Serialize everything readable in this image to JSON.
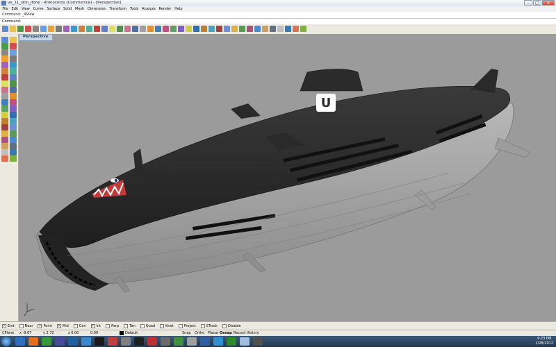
{
  "window": {
    "title": "ve_11_skin_done - Rhinoceros (Commercial) - [Perspective]",
    "min": "–",
    "max": "□",
    "close": "✕"
  },
  "menu": [
    "File",
    "Edit",
    "View",
    "Curve",
    "Surface",
    "Solid",
    "Mesh",
    "Dimension",
    "Transform",
    "Tools",
    "Analyze",
    "Render",
    "Help"
  ],
  "command": {
    "history_line": "Command: _4View",
    "prompt_label": "Command:",
    "value": ""
  },
  "viewport": {
    "name": "Perspective",
    "logo_text": "U"
  },
  "osnaps": [
    {
      "label": "End",
      "checked": true
    },
    {
      "label": "Near",
      "checked": false
    },
    {
      "label": "Point",
      "checked": true
    },
    {
      "label": "Mid",
      "checked": true
    },
    {
      "label": "Cen",
      "checked": false
    },
    {
      "label": "Int",
      "checked": true
    },
    {
      "label": "Perp",
      "checked": false
    },
    {
      "label": "Tan",
      "checked": false
    },
    {
      "label": "Quad",
      "checked": false
    },
    {
      "label": "Knot",
      "checked": false
    },
    {
      "label": "Project",
      "checked": false
    },
    {
      "label": "STrack",
      "checked": false
    },
    {
      "label": "Disable",
      "checked": false
    }
  ],
  "status": {
    "cplane": "CPlane",
    "x": "x -9.67",
    "y": "y 2.72",
    "z": "z 0.00",
    "dist": "0.00",
    "layer": "Default",
    "snap": "Snap",
    "ortho": "Ortho",
    "planar": "Planar",
    "osnap": "Osnap",
    "history": "Record History"
  },
  "clock": {
    "time": "9:23 PM",
    "date": "2/28/2012"
  },
  "colors": {
    "viewport_bg": "#9b9b9b",
    "hull_dark": "#2e2e2e",
    "hull_light": "#a9a9a9"
  }
}
